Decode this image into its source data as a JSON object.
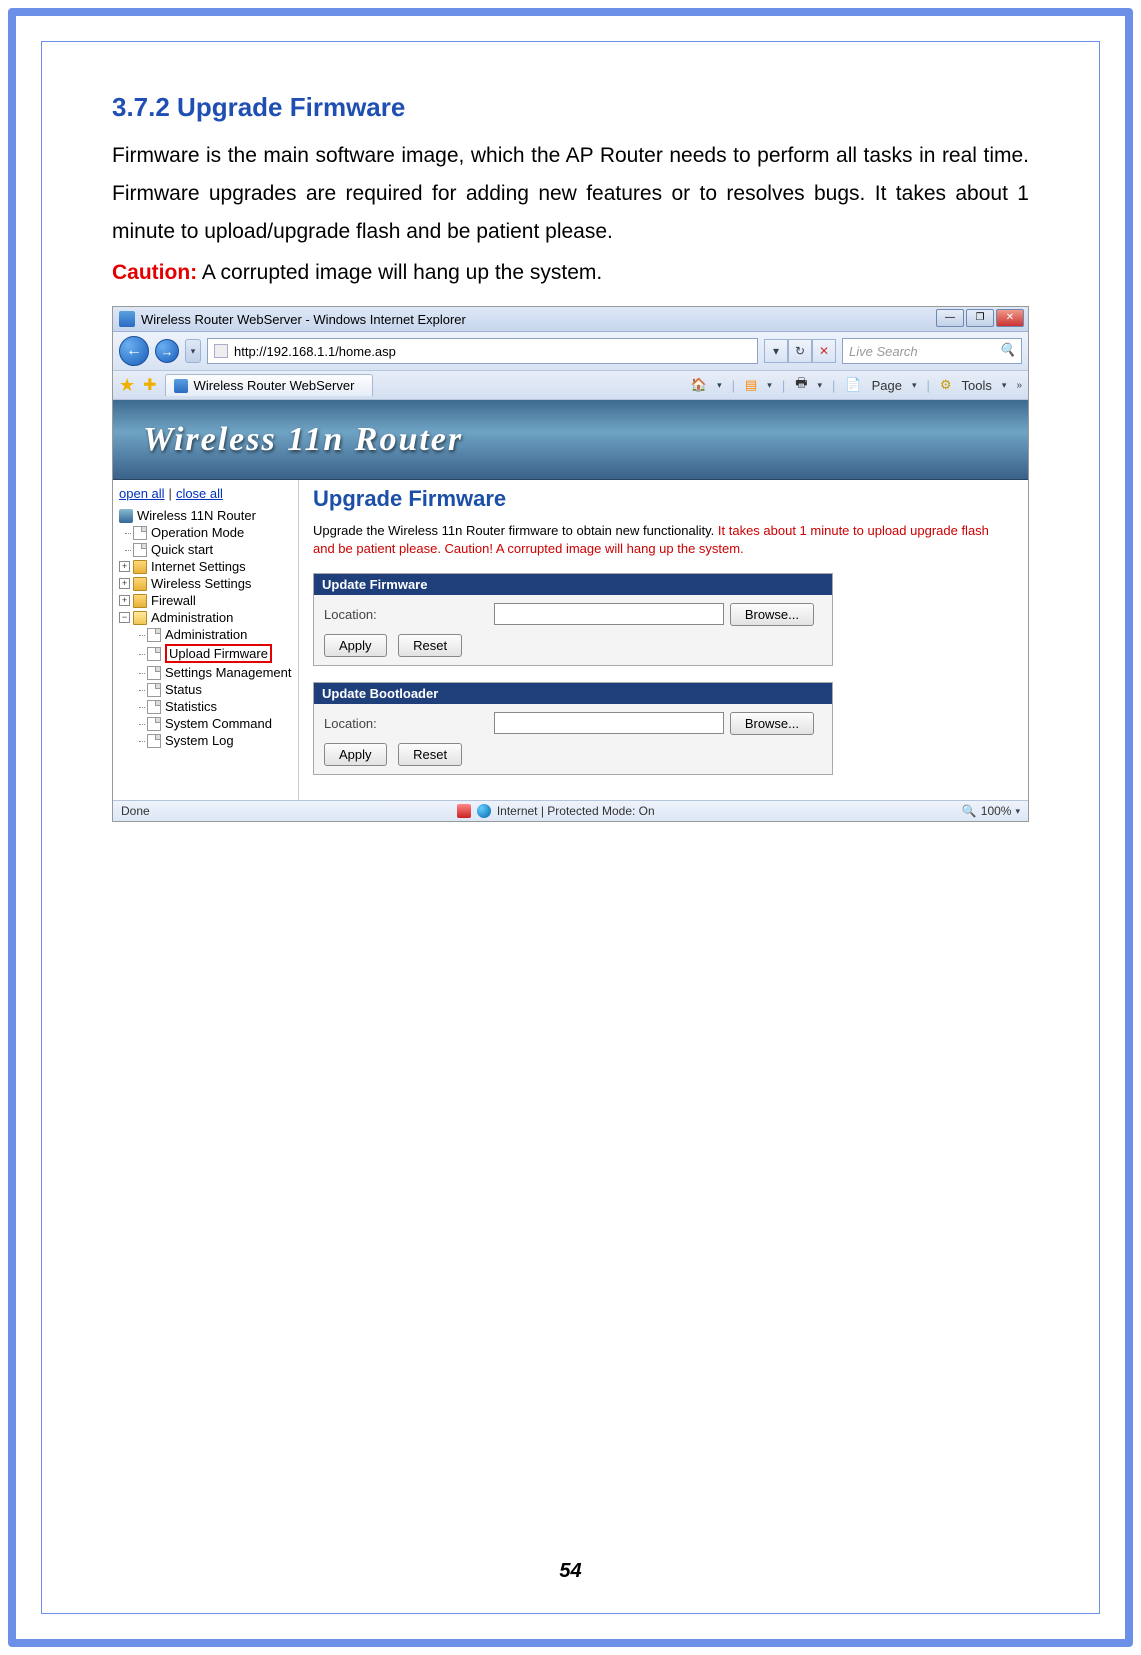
{
  "doc": {
    "heading": "3.7.2   Upgrade Firmware",
    "p1": "Firmware is the main software image, which the AP Router needs to perform all tasks in real time. Firmware upgrades are required for adding new features or to resolves bugs. It takes about 1 minute to upload/upgrade flash and be patient please.",
    "caution_label": "Caution:",
    "caution_text": " A corrupted image will hang up the system.",
    "page_number": "54"
  },
  "browser": {
    "title": "Wireless Router WebServer - Windows Internet Explorer",
    "url": "http://192.168.1.1/home.asp",
    "search_placeholder": "Live Search",
    "tab_title": "Wireless Router WebServer",
    "toolbar": {
      "page": "Page",
      "tools": "Tools"
    },
    "status_left": "Done",
    "status_mode": "Internet | Protected Mode: On",
    "zoom": "100%"
  },
  "router": {
    "banner": "Wireless  11n  Router",
    "sidebar": {
      "open_all": "open all",
      "close_all": "close all",
      "root": "Wireless 11N Router",
      "items": {
        "operation_mode": "Operation Mode",
        "quick_start": "Quick start",
        "internet_settings": "Internet Settings",
        "wireless_settings": "Wireless Settings",
        "firewall": "Firewall",
        "administration": "Administration",
        "admin_sub": "Administration",
        "upload_firmware": "Upload Firmware",
        "settings_mgmt": "Settings Management",
        "status": "Status",
        "statistics": "Statistics",
        "system_command": "System Command",
        "system_log": "System Log"
      }
    },
    "main": {
      "title": "Upgrade Firmware",
      "desc_plain": "Upgrade the Wireless 11n Router firmware to obtain new functionality. ",
      "desc_warn": "It takes about 1 minute to upload   upgrade flash and be patient please. Caution! A corrupted image will hang up the system.",
      "panel1_title": "Update Firmware",
      "panel2_title": "Update Bootloader",
      "location_label": "Location:",
      "browse": "Browse...",
      "apply": "Apply",
      "reset": "Reset"
    }
  }
}
